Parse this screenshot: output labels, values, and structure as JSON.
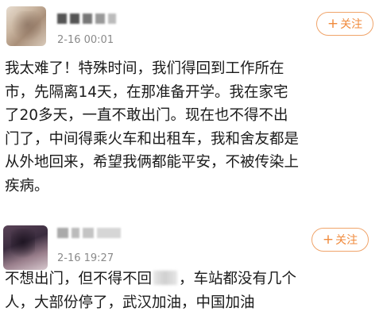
{
  "posts": [
    {
      "avatar_icon": "user-avatar-icon",
      "timestamp": "2-16 00:01",
      "follow_label": "关注",
      "follow_icon": "plus-icon",
      "accent_color": "#f08a3c",
      "content_lines": [
        "我太难了！特殊时间，我们得回到工作所在",
        "市，先隔离14天，在那准备开学。我在家宅",
        "了20多天，一直不敢出门。现在也不得不出",
        "门了，中间得乘火车和出租车，我和舍友都是",
        "从外地回来，希望我俩都能平安，不被传染上",
        "疾病。"
      ]
    },
    {
      "avatar_icon": "user-avatar-icon",
      "timestamp": "2-16 19:27",
      "follow_label": "关注",
      "follow_icon": "plus-icon",
      "accent_color": "#f08a3c",
      "content_line1_before": "不想出门，但不得不回",
      "content_line1_after": "，车站都没有几个",
      "content_line2": "人，大部份停了，武汉加油，中国加油"
    }
  ]
}
